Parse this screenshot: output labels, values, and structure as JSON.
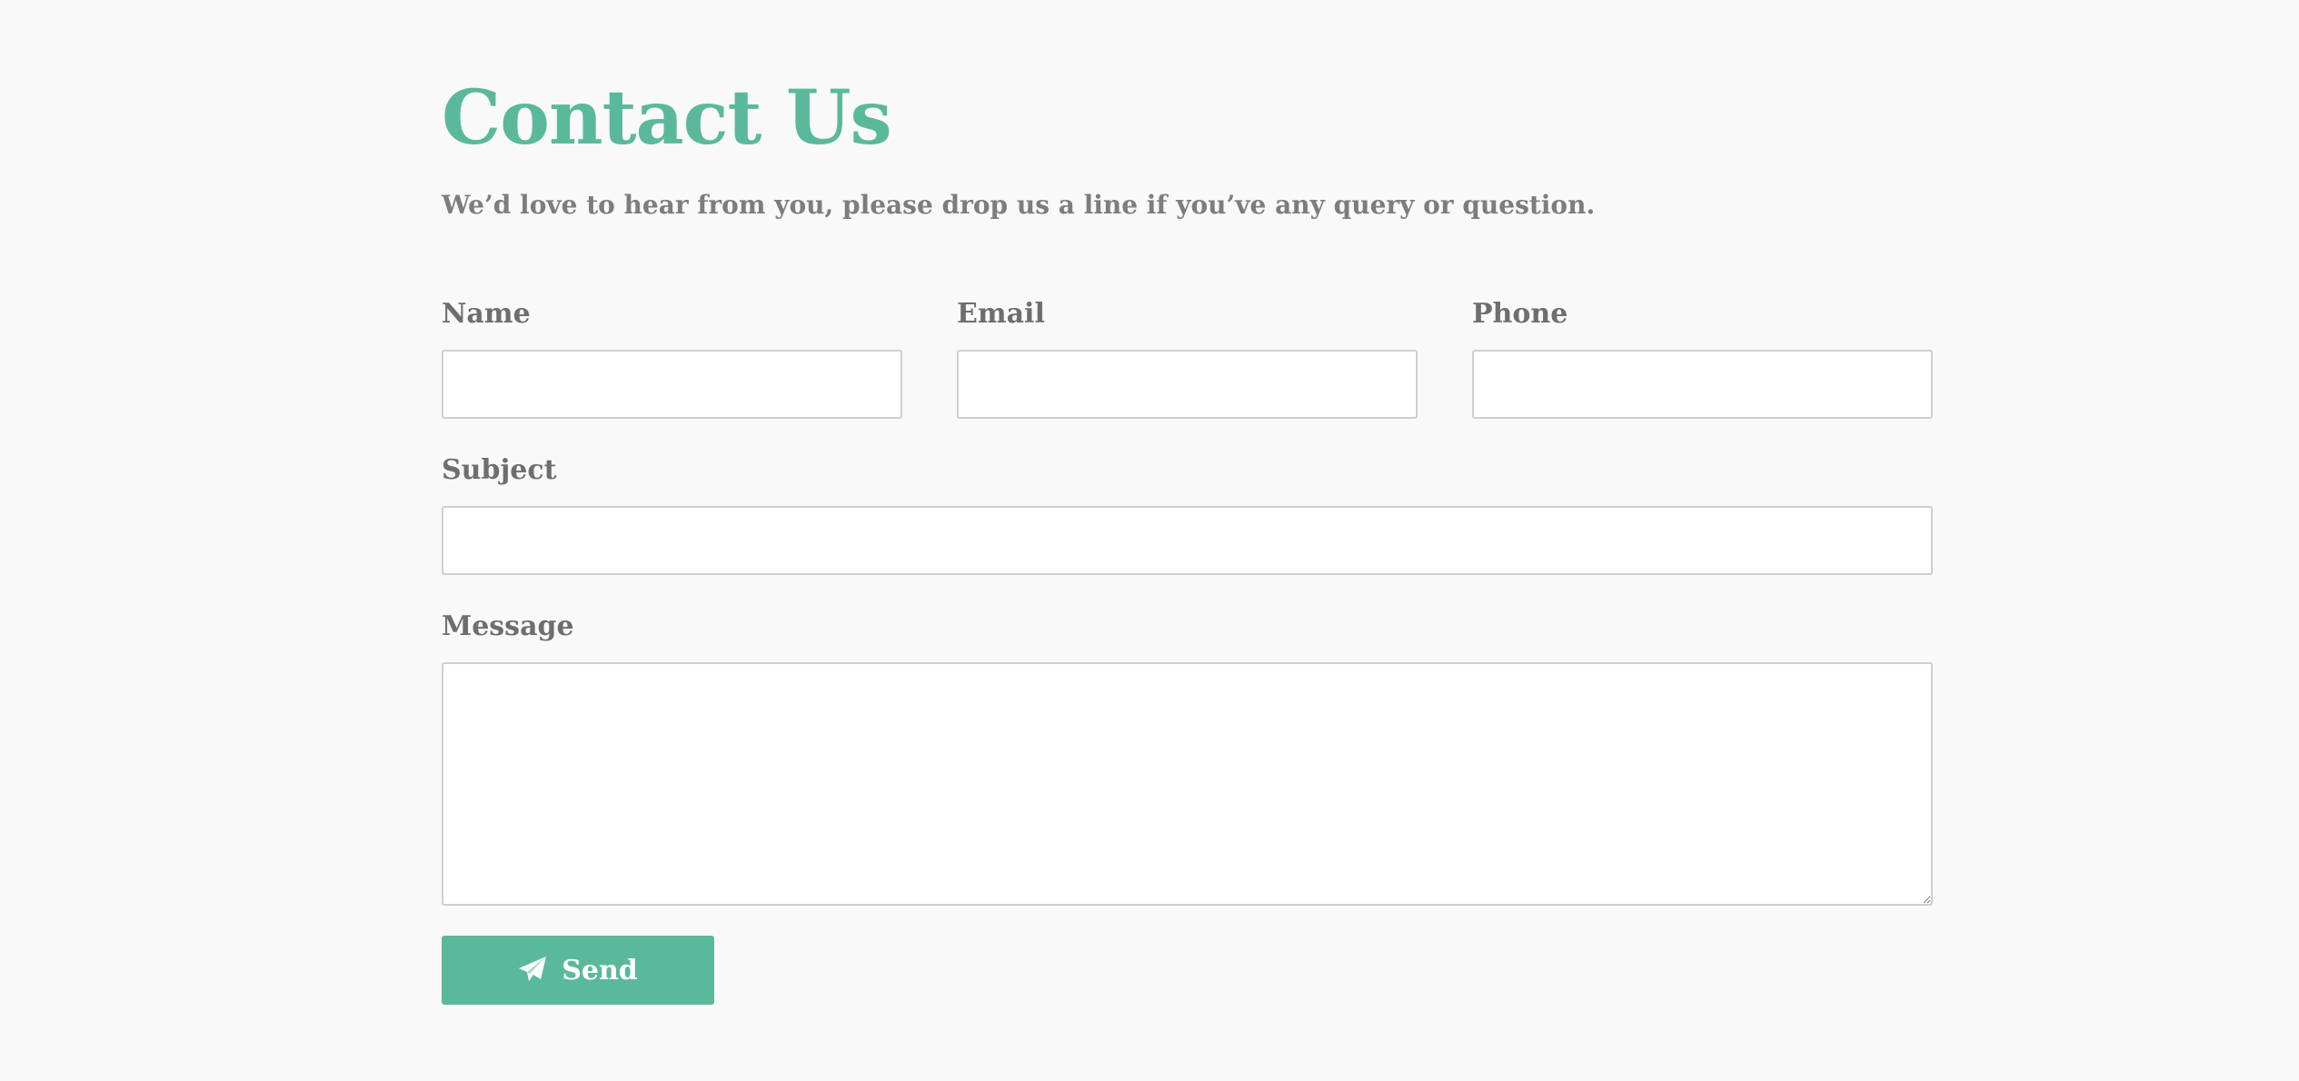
{
  "header": {
    "title": "Contact Us",
    "subtitle": "We’d love to hear from you, please drop us a line if you’ve any query or question."
  },
  "form": {
    "name_label": "Name",
    "name_value": "",
    "email_label": "Email",
    "email_value": "",
    "phone_label": "Phone",
    "phone_value": "",
    "subject_label": "Subject",
    "subject_value": "",
    "message_label": "Message",
    "message_value": "",
    "send_label": "Send",
    "send_icon": "paper-plane-icon"
  },
  "colors": {
    "accent": "#5bb99b",
    "label": "#6e6e6e",
    "subtitle": "#7d7d7d",
    "background": "#f9f9f9",
    "input_border": "#cfcfcf"
  }
}
